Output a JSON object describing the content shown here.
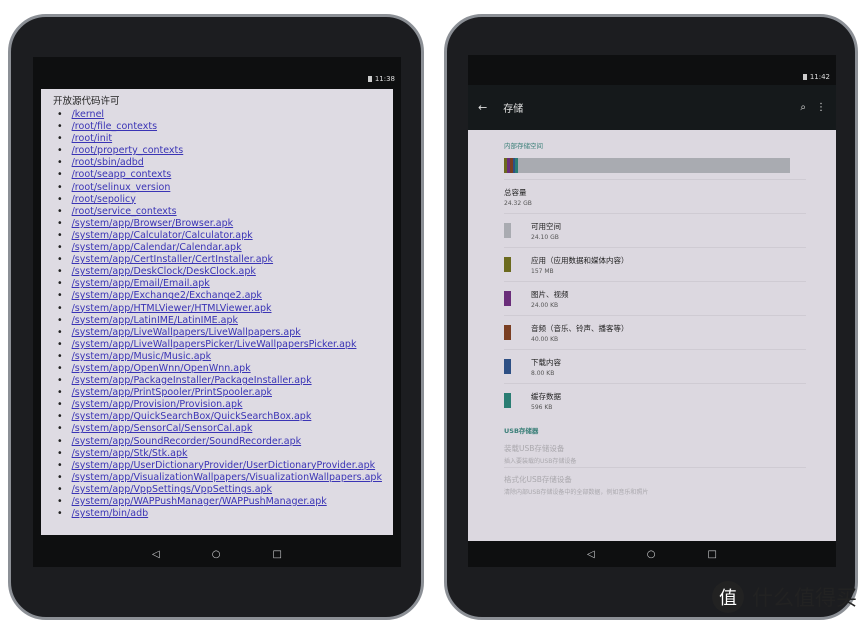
{
  "left": {
    "status_time": "11:38",
    "title": "开放源代码许可",
    "items": [
      "/kernel",
      "/root/file_contexts",
      "/root/init",
      "/root/property_contexts",
      "/root/sbin/adbd",
      "/root/seapp_contexts",
      "/root/selinux_version",
      "/root/sepolicy",
      "/root/service_contexts",
      "/system/app/Browser/Browser.apk",
      "/system/app/Calculator/Calculator.apk",
      "/system/app/Calendar/Calendar.apk",
      "/system/app/CertInstaller/CertInstaller.apk",
      "/system/app/DeskClock/DeskClock.apk",
      "/system/app/Email/Email.apk",
      "/system/app/Exchange2/Exchange2.apk",
      "/system/app/HTMLViewer/HTMLViewer.apk",
      "/system/app/LatinIME/LatinIME.apk",
      "/system/app/LiveWallpapers/LiveWallpapers.apk",
      "/system/app/LiveWallpapersPicker/LiveWallpapersPicker.apk",
      "/system/app/Music/Music.apk",
      "/system/app/OpenWnn/OpenWnn.apk",
      "/system/app/PackageInstaller/PackageInstaller.apk",
      "/system/app/PrintSpooler/PrintSpooler.apk",
      "/system/app/Provision/Provision.apk",
      "/system/app/QuickSearchBox/QuickSearchBox.apk",
      "/system/app/SensorCal/SensorCal.apk",
      "/system/app/SoundRecorder/SoundRecorder.apk",
      "/system/app/Stk/Stk.apk",
      "/system/app/UserDictionaryProvider/UserDictionaryProvider.apk",
      "/system/app/VisualizationWallpapers/VisualizationWallpapers.apk",
      "/system/app/VppSettings/VppSettings.apk",
      "/system/app/WAPPushManager/WAPPushManager.apk",
      "/system/bin/adb"
    ]
  },
  "right": {
    "status_time": "11:42",
    "title": "存储",
    "internal_header": "内部存储空间",
    "total": {
      "label": "总容量",
      "value": "24.32 GB"
    },
    "categories": [
      {
        "label": "可用空间",
        "value": "24.10 GB",
        "color": "#a9abb1"
      },
      {
        "label": "应用（应用数据和媒体内容）",
        "value": "157 MB",
        "color": "#6b6a1e"
      },
      {
        "label": "图片、视频",
        "value": "24.00 KB",
        "color": "#6a2d7a"
      },
      {
        "label": "音频（音乐、铃声、播客等）",
        "value": "40.00 KB",
        "color": "#7a3e22"
      },
      {
        "label": "下载内容",
        "value": "8.00 KB",
        "color": "#2d4f84"
      },
      {
        "label": "缓存数据",
        "value": "596 KB",
        "color": "#2a7d73"
      }
    ],
    "usb_header": "USB存储器",
    "mount": {
      "title": "装载USB存储设备",
      "desc": "插入要装载的USB存储设备"
    },
    "format": {
      "title": "格式化USB存储设备",
      "desc": "清除内部USB存储设备中的全部数据，例如音乐和照片"
    }
  },
  "nav": {
    "back": "◁",
    "home": "○",
    "recents": "□"
  },
  "watermark": "什么值得买"
}
